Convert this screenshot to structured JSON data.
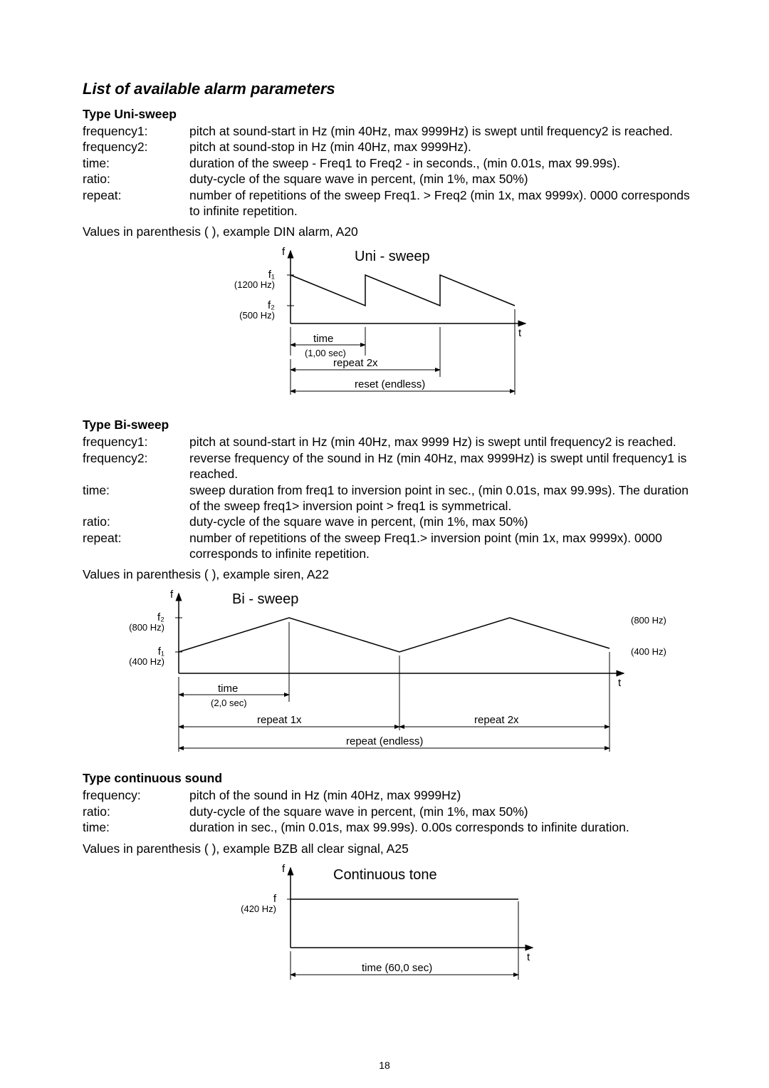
{
  "title": "List of available alarm parameters",
  "pagenum": "18",
  "uni": {
    "head": "Type Uni-sweep",
    "rows": [
      {
        "l": "frequency1:",
        "d": "pitch at sound-start in Hz (min 40Hz, max 9999Hz) is swept until frequency2 is reached."
      },
      {
        "l": "frequency2:",
        "d": "pitch at sound-stop in Hz (min 40Hz, max 9999Hz)."
      },
      {
        "l": "time:",
        "d": "duration of the sweep - Freq1 to Freq2 - in seconds., (min 0.01s, max 99.99s)."
      },
      {
        "l": "ratio:",
        "d": "duty-cycle of the square wave in percent, (min 1%, max 50%)"
      },
      {
        "l": "repeat:",
        "d": "number of repetitions of the sweep Freq1. >  Freq2 (min 1x, max 9999x). 0000 corresponds to infinite repetition."
      }
    ],
    "example": "Values in parenthesis ( ), example DIN alarm, A20",
    "fig": {
      "title": "Uni  -  sweep",
      "f1": "f₁",
      "f1hz": "(1200 Hz)",
      "f2": "f₂",
      "f2hz": "(500 Hz)",
      "time": "time",
      "time_sub": "(1,00 sec)",
      "repeat": "repeat 2x",
      "reset": "reset (endless)",
      "yaxis": "f",
      "xaxis": "t"
    }
  },
  "bi": {
    "head": "Type Bi-sweep",
    "rows": [
      {
        "l": "frequency1:",
        "d": "pitch at sound-start in Hz (min 40Hz, max 9999 Hz) is swept until frequency2 is reached."
      },
      {
        "l": "frequency2:",
        "d": " reverse frequency of the sound in Hz (min 40Hz, max 9999Hz) is swept until frequency1 is reached."
      },
      {
        "l": "time:",
        "d": "sweep duration from freq1 to inversion point in sec., (min 0.01s, max 99.99s). The duration of the sweep freq1> inversion point > freq1 is symmetrical."
      },
      {
        "l": "ratio:",
        "d": "duty-cycle of the square wave in percent, (min 1%, max 50%)"
      },
      {
        "l": "repeat:",
        "d": "number of repetitions of the sweep Freq1.> inversion point (min 1x, max 9999x). 0000 corresponds to infinite repetition."
      }
    ],
    "example": "Values in parenthesis ( ), example siren, A22",
    "fig": {
      "title": "Bi  -  sweep",
      "f1": "f₁",
      "f1hz": "(400 Hz)",
      "f2": "f₂",
      "f2hz": "(800 Hz)",
      "right_top": "(800 Hz)",
      "right_bot": "(400 Hz)",
      "time": "time",
      "time_sub": "(2,0 sec)",
      "r1": "repeat 1x",
      "r2": "repeat 2x",
      "re": "repeat (endless)",
      "yaxis": "f",
      "xaxis": "t"
    }
  },
  "cont": {
    "head": "Type continuous sound",
    "rows": [
      {
        "l": "frequency:",
        "d": "pitch of the sound in Hz (min 40Hz, max 9999Hz)"
      },
      {
        "l": "ratio:",
        "d": "duty-cycle of the square wave in percent, (min 1%, max 50%)"
      },
      {
        "l": "time:",
        "d": "duration in sec., (min 0.01s, max 99.99s). 0.00s corresponds to infinite duration."
      }
    ],
    "example": "Values in parenthesis ( ), example BZB all clear signal, A25",
    "fig": {
      "title": "Continuous  tone",
      "f": "f",
      "fhz": "(420 Hz)",
      "time": "time (60,0 sec)",
      "yaxis": "f",
      "xaxis": "t"
    }
  }
}
